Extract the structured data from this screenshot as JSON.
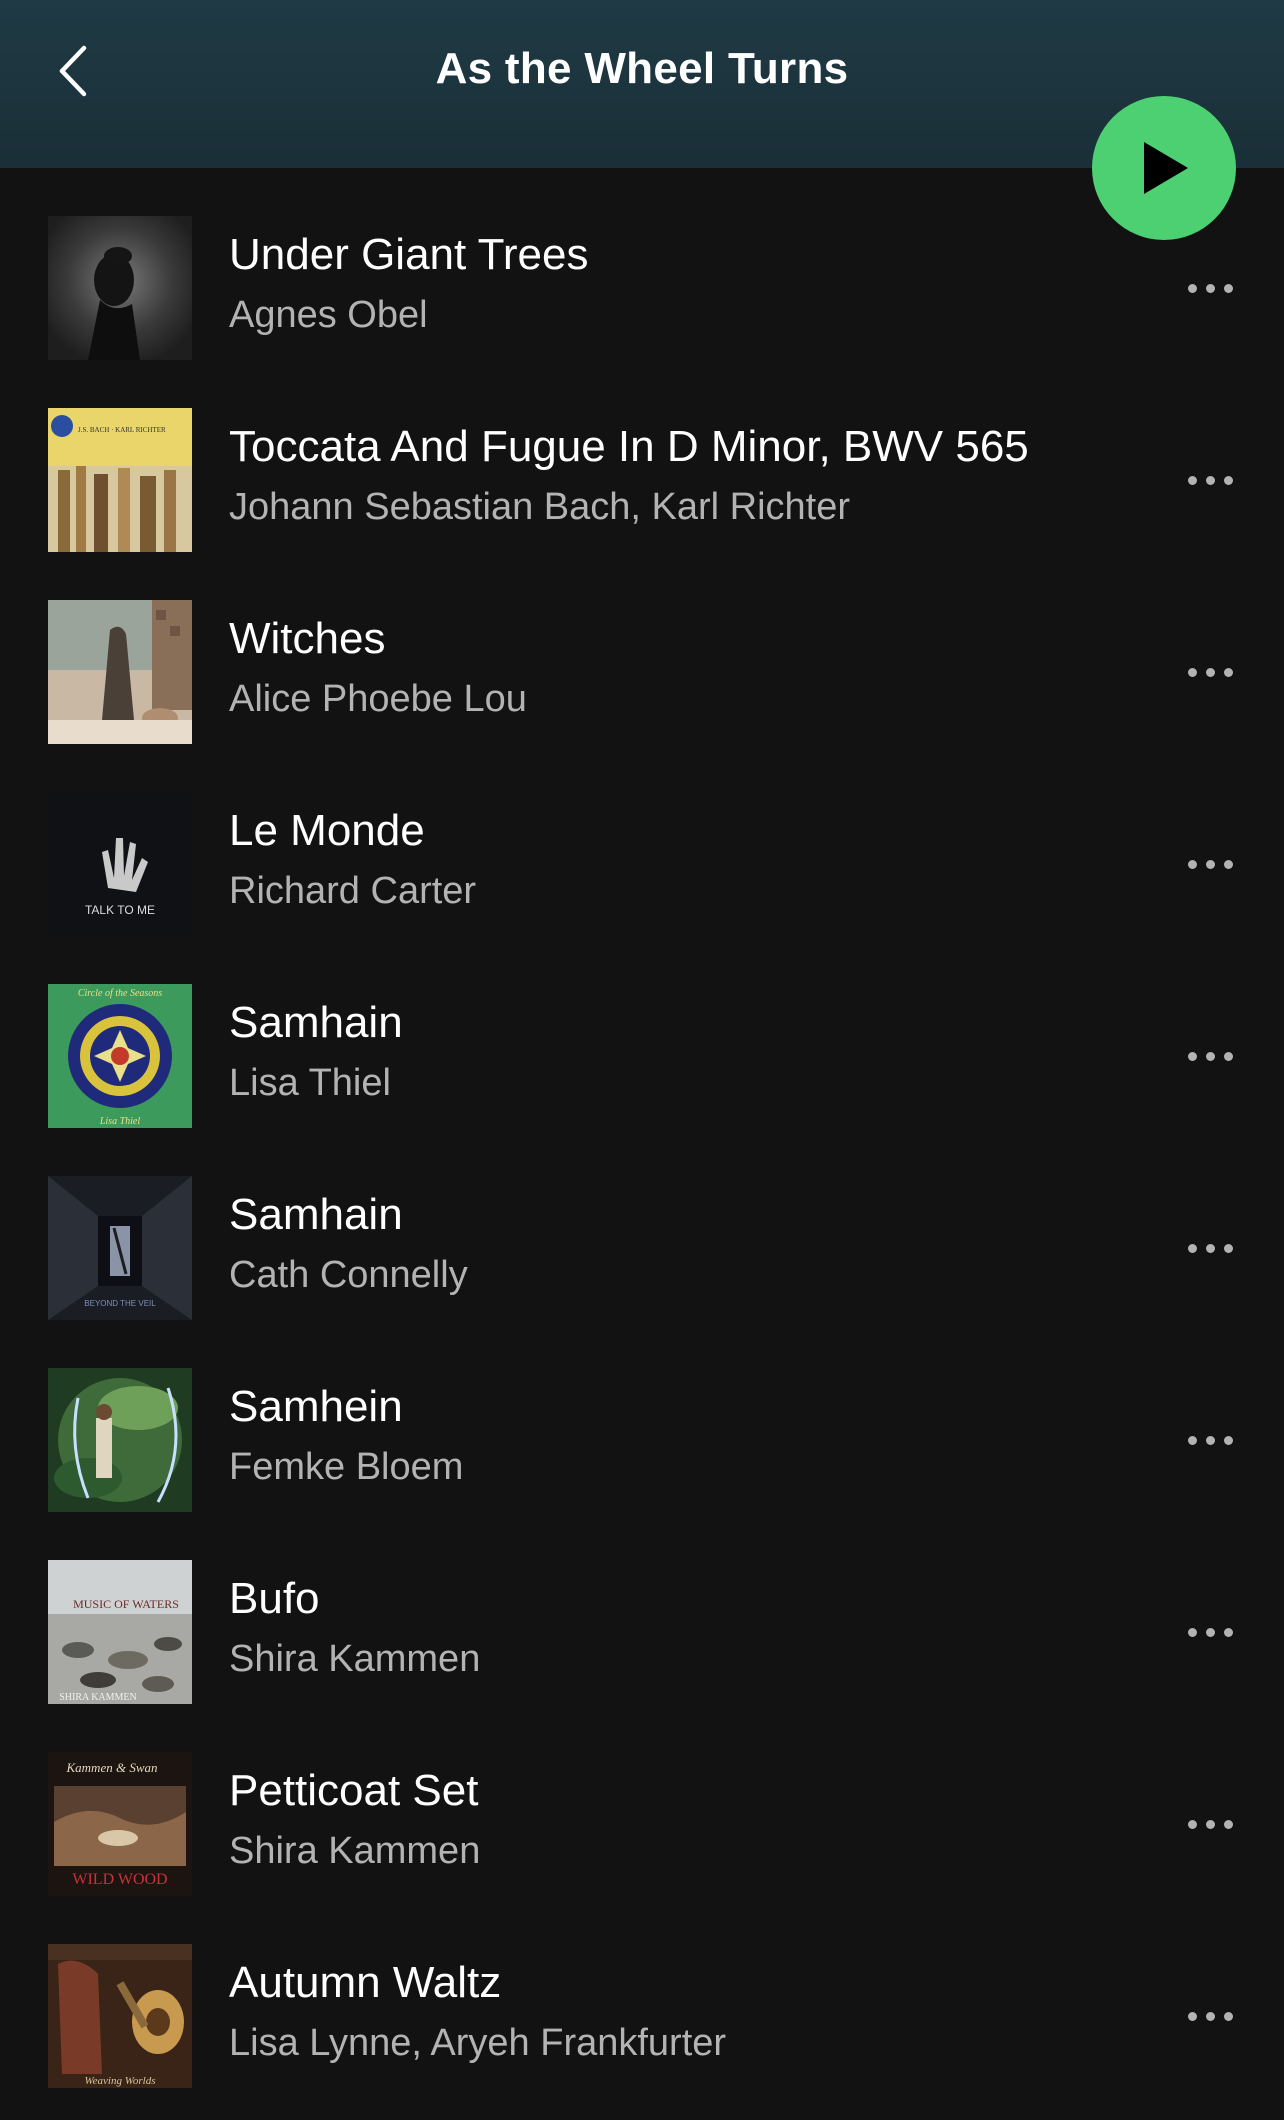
{
  "header": {
    "title": "As the Wheel Turns",
    "back_icon": "chevron-left-icon",
    "play_icon": "play-icon"
  },
  "colors": {
    "header_bg": "#1f3a44",
    "background": "#121212",
    "accent_green": "#4cd072",
    "secondary_text": "#b3b3b3"
  },
  "tracks": [
    {
      "title": "Under Giant Trees",
      "artist": "Agnes Obel"
    },
    {
      "title": "Toccata And Fugue In D Minor, BWV 565",
      "artist": "Johann Sebastian Bach, Karl Richter",
      "cover_text": "J.S. BACH · KARL RICHTER"
    },
    {
      "title": "Witches",
      "artist": "Alice Phoebe Lou"
    },
    {
      "title": "Le Monde",
      "artist": "Richard Carter",
      "cover_text": "TALK TO ME"
    },
    {
      "title": "Samhain",
      "artist": "Lisa Thiel",
      "cover_text": "Circle of the Seasons",
      "cover_text_2": "Lisa Thiel"
    },
    {
      "title": "Samhain",
      "artist": "Cath Connelly",
      "cover_text": "BEYOND THE VEIL"
    },
    {
      "title": "Samhein",
      "artist": "Femke Bloem"
    },
    {
      "title": "Bufo",
      "artist": "Shira Kammen",
      "cover_text": "MUSIC OF WATERS",
      "cover_text_2": "SHIRA KAMMEN"
    },
    {
      "title": "Petticoat Set",
      "artist": "Shira Kammen",
      "cover_text": "Kammen & Swan",
      "cover_text_2": "WILD WOOD"
    },
    {
      "title": "Autumn Waltz",
      "artist": "Lisa Lynne, Aryeh Frankfurter",
      "cover_text": "Weaving Worlds"
    }
  ]
}
